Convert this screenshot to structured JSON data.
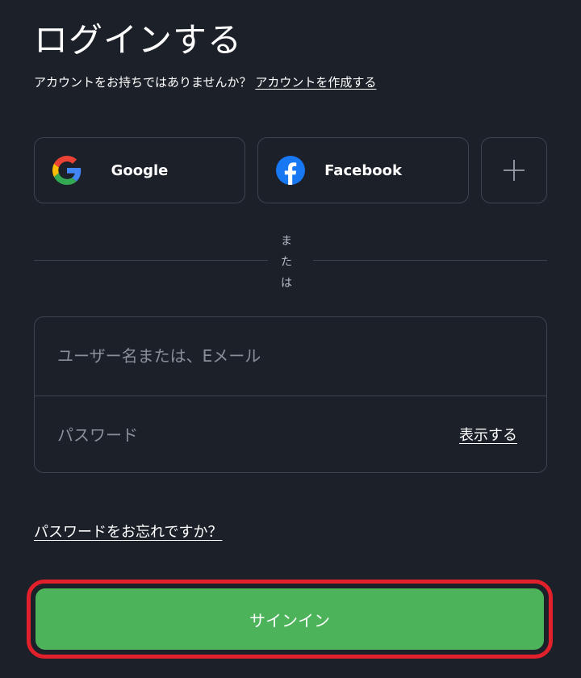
{
  "header": {
    "title": "ログインする",
    "prompt": "アカウントをお持ちではありませんか？",
    "create_account_link": "アカウントを作成する"
  },
  "social": {
    "google_label": "Google",
    "facebook_label": "Facebook",
    "google_icon": "google-icon",
    "facebook_icon": "facebook-icon",
    "more_icon": "plus-icon",
    "facebook_color": "#1877f2"
  },
  "divider": {
    "text": "または"
  },
  "form": {
    "username_placeholder": "ユーザー名または、Eメール",
    "username_value": "",
    "password_placeholder": "パスワード",
    "password_value": "",
    "show_password": "表示する"
  },
  "forgot_password": "パスワードをお忘れですか？",
  "signin_label": "サインイン",
  "colors": {
    "background": "#1c2029",
    "border": "#3d4350",
    "signin": "#4cb35a",
    "highlight": "#e0202a"
  }
}
